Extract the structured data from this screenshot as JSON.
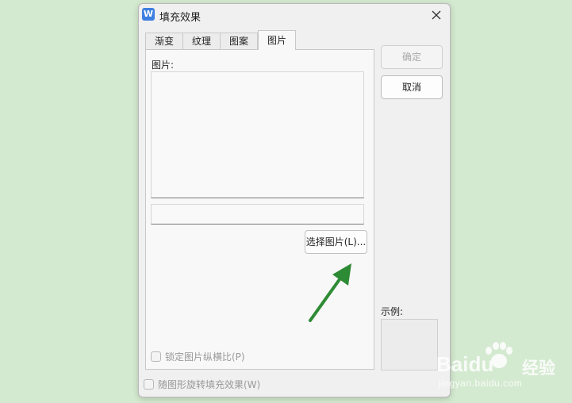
{
  "window": {
    "title": "填充效果",
    "app_icon": "W"
  },
  "tabs": [
    {
      "label": "渐变",
      "active": false
    },
    {
      "label": "纹理",
      "active": false
    },
    {
      "label": "图案",
      "active": false
    },
    {
      "label": "图片",
      "active": true
    }
  ],
  "picture_panel": {
    "label": "图片:",
    "path_value": "",
    "select_button": "选择图片(L)...",
    "lock_aspect_label": "锁定图片纵横比(P)",
    "lock_aspect_checked": false
  },
  "rotate_with_shape_label": "随图形旋转填充效果(W)",
  "rotate_with_shape_checked": false,
  "buttons": {
    "ok": "确定",
    "cancel": "取消"
  },
  "example_label": "示例:",
  "annotation": {
    "arrow_color": "#2e8b35",
    "points_to": "select-picture-button"
  },
  "watermark": {
    "brand": "Baidu",
    "cn": "经验",
    "url": "jingyan.baidu.com"
  },
  "colors": {
    "background": "#d4ead0",
    "dialog": "#f0f0f0",
    "accent": "#3d7fe0"
  }
}
